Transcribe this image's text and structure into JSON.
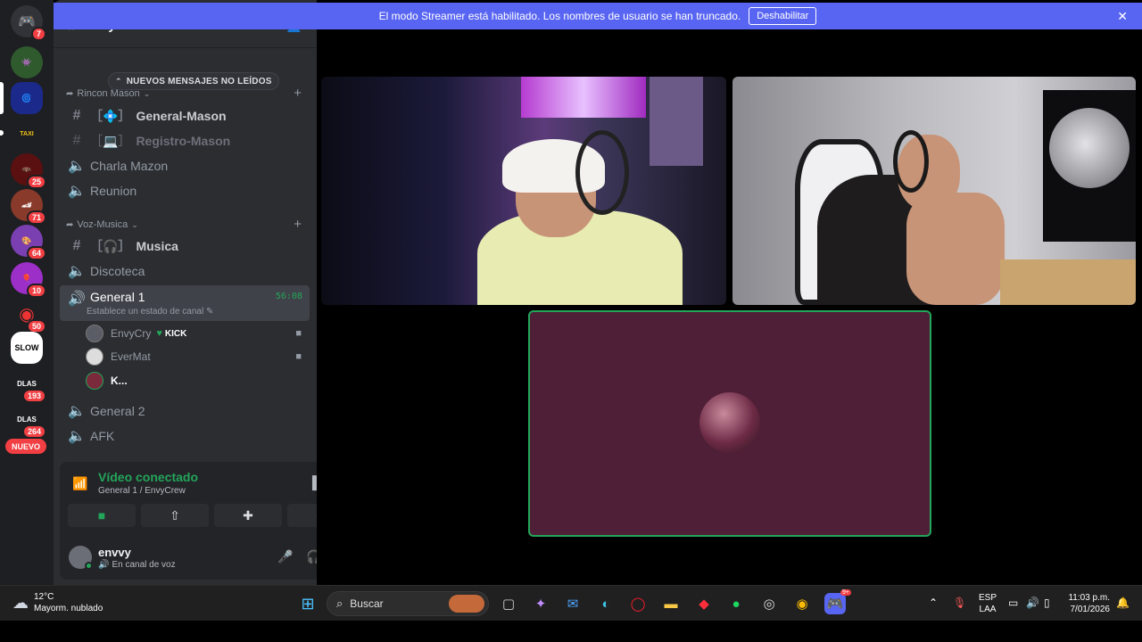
{
  "banner": {
    "text": "El modo Streamer está habilitado. Los nombres de usuario se han truncado.",
    "button": "Deshabilitar"
  },
  "rail": {
    "home_badge": "7",
    "badges": [
      "25",
      "71",
      "64",
      "10",
      "50",
      "193",
      "264"
    ],
    "new_label": "NUEVO"
  },
  "guild": {
    "name": "EnvyCrew",
    "unread_pill": "NUEVOS MENSAJES NO LEÍDOS"
  },
  "categories": {
    "rincon": "Rincon Mason",
    "voz": "Voz-Musica"
  },
  "channels": {
    "general_mason": "General-Mason",
    "registro_mason": "Registro-Mason",
    "charla_mazon": "Charla Mazon",
    "reunion": "Reunion",
    "musica": "Musica",
    "discoteca": "Discoteca",
    "general1": "General 1",
    "general1_time": "56:08",
    "general1_status": "Establece un estado de canal",
    "general2": "General 2",
    "afk": "AFK"
  },
  "voice_users": [
    {
      "name": "EnvyCry",
      "badge": "KICK"
    },
    {
      "name": "EverMat"
    },
    {
      "name": "K..."
    }
  ],
  "voice_panel": {
    "title": "Vídeo conectado",
    "subtitle": "General 1 / EnvyCrew"
  },
  "user_panel": {
    "name": "envvy",
    "status": "En canal de voz"
  },
  "taskbar": {
    "weather_temp": "12°C",
    "weather_desc": "Mayorm. nublado",
    "search_placeholder": "Buscar",
    "discord_badge": "9+",
    "lang_line1": "ESP",
    "lang_line2": "LAA",
    "time": "11:03 p.m.",
    "date": "7/01/2026"
  }
}
